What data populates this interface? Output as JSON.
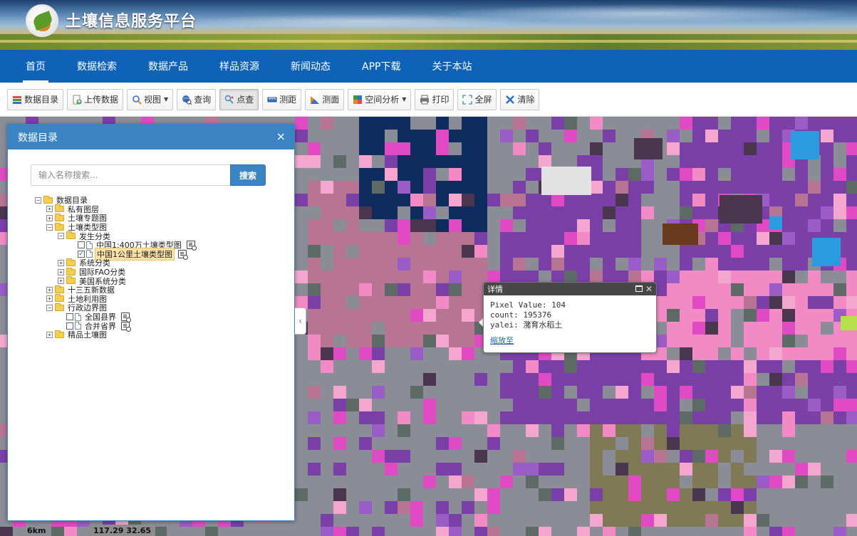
{
  "site": {
    "title": "土壤信息服务平台",
    "logo_icon": "soil-leaf-logo"
  },
  "nav": {
    "items": [
      {
        "label": "首页",
        "active": true
      },
      {
        "label": "数据检索",
        "active": false
      },
      {
        "label": "数据产品",
        "active": false
      },
      {
        "label": "样品资源",
        "active": false
      },
      {
        "label": "新闻动态",
        "active": false
      },
      {
        "label": "APP下载",
        "active": false
      },
      {
        "label": "关于本站",
        "active": false
      }
    ]
  },
  "toolbar": {
    "catalog": "数据目录",
    "upload": "上传数据",
    "view": "视图",
    "query": "查询",
    "point_query": "点查",
    "measure_distance": "测距",
    "measure_area": "测面",
    "spatial_analysis": "空间分析",
    "print": "打印",
    "fullscreen": "全屏",
    "clear": "清除"
  },
  "catalog_panel": {
    "title": "数据目录",
    "close": "×",
    "search_placeholder": "输入名称搜索...",
    "search_button": "搜索",
    "tree": {
      "root": "数据目录",
      "private_layers": "私有图层",
      "soil_thematic": "土壤专题图",
      "soil_type": "土壤类型图",
      "genetic": "发生分类",
      "layer_400": "中国1:400万土壤类型图",
      "layer_1km": "中国1公里土壤类型图",
      "systematic": "系统分类",
      "fao": "国际FAO分类",
      "usda": "美国系统分类",
      "fifteen": "十三五新数据",
      "landuse": "土地利用图",
      "admin": "行政边界图",
      "county": "全国县界",
      "province": "合并省界",
      "premium": "精品土壤图"
    }
  },
  "popup": {
    "title": "详情",
    "pixel_value": "Pixel Value: 104",
    "count": "count: 195376",
    "yalei": "yalei: 潴育水稻土",
    "zoom_link": "缩放至"
  },
  "status": {
    "scale": "6km",
    "coords": "117.29 32.65"
  },
  "colors": {
    "nav_bg": "#0e63b8",
    "panel_header": "#3b84c4",
    "map_purple": "#7b3fa8",
    "map_pink": "#f28ac5",
    "map_magenta": "#e04bc3",
    "map_grey": "#8a8c96",
    "map_navy": "#0e2c5e"
  }
}
